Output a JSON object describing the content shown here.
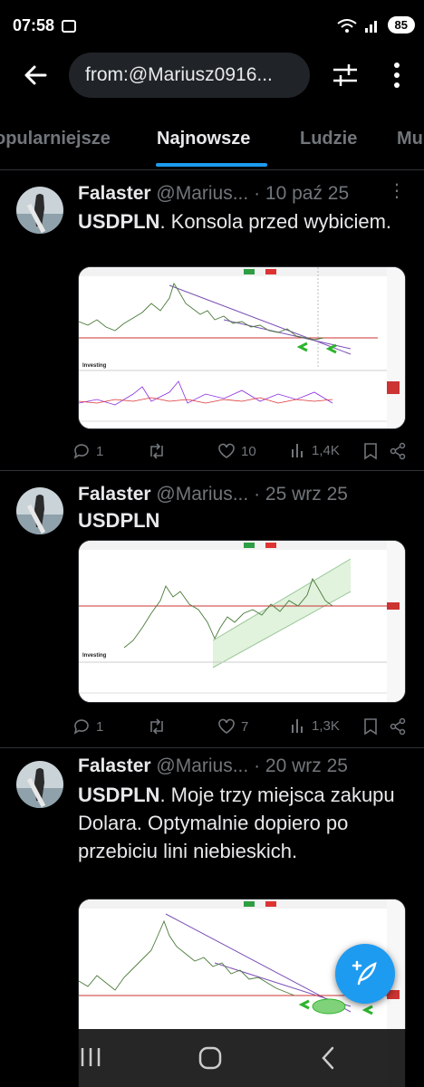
{
  "status": {
    "time": "07:58",
    "battery": "85"
  },
  "search": {
    "query": "from:@Mariusz0916..."
  },
  "tabs": [
    {
      "label": "opularniejsze"
    },
    {
      "label": "Najnowsze"
    },
    {
      "label": "Ludzie"
    },
    {
      "label": "Mu"
    }
  ],
  "tweets": [
    {
      "name": "Falaster",
      "handle": "@Marius...",
      "date": "· 10 paź 25",
      "text_bold": "USDPLN",
      "text_rest": ". Konsola przed wybiciem.",
      "replies": "1",
      "likes": "10",
      "views": "1,4K"
    },
    {
      "name": "Falaster",
      "handle": "@Marius...",
      "date": "· 25 wrz 25",
      "text_bold": "USDPLN",
      "text_rest": "",
      "replies": "1",
      "likes": "7",
      "views": "1,3K"
    },
    {
      "name": "Falaster",
      "handle": "@Marius...",
      "date": "· 20 wrz 25",
      "text_bold": "USDPLN",
      "text_rest": ". Moje trzy miejsca zakupu Dolara. Optymalnie dopiero po przebiciu lini niebieskich."
    }
  ],
  "colors": {
    "accent": "#1d9bf0",
    "muted": "#71767b",
    "background": "#000000"
  }
}
